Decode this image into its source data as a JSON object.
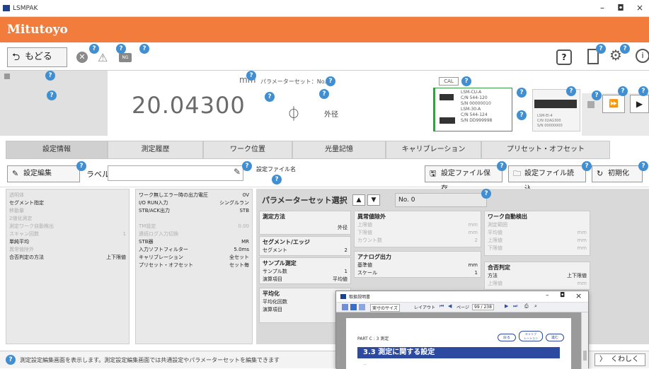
{
  "window": {
    "title": "LSMPAK",
    "minimize": "–",
    "maximize": "◘",
    "close": "×"
  },
  "brand": {
    "name": "Mitutoyo"
  },
  "toolbar": {
    "back_label": "もどる",
    "ng_label": "NG"
  },
  "help_badge": "?",
  "display": {
    "value": "20.04300",
    "unit": "mm",
    "param_set": "パラメーターセット：No. 0",
    "measure_label": "外径",
    "cal_label": "CAL",
    "device1": {
      "lines": [
        "LSM-CU-A",
        "C/N 544-120",
        "S/N 00000010",
        "LSM-30-A",
        "C/N 544-124",
        "S/N DD999998"
      ]
    },
    "device2": {
      "lines": [
        "LSM-EI-4",
        "C/N 02AG300",
        "S/N 00000000"
      ]
    }
  },
  "tabs": [
    "設定情報",
    "測定履歴",
    "ワーク位置",
    "光量記憶",
    "キャリブレーション",
    "プリセット・オフセット"
  ],
  "ctrl": {
    "edit_btn": "設定編集",
    "label_text": "ラベル",
    "label_value": "",
    "file_name_label": "設定ファイル名",
    "save_btn": "設定ファイル保存",
    "load_btn": "設定ファイル読込",
    "init_btn": "初期化"
  },
  "list1": [
    {
      "k": "透明体",
      "v": "",
      "dim": true
    },
    {
      "k": "セグメント指定",
      "v": "",
      "dim": false
    },
    {
      "k": "移動量",
      "v": "",
      "dim": true
    },
    {
      "k": "2値化測定",
      "v": "",
      "dim": true
    },
    {
      "k": "測定ワーク自動検出",
      "v": "",
      "dim": true
    },
    {
      "k": "スキャン回数",
      "v": "1",
      "dim": true
    },
    {
      "k": "単純平均",
      "v": "",
      "dim": false
    },
    {
      "k": "異常値除外",
      "v": "",
      "dim": true
    },
    {
      "k": "合否判定の方法",
      "v": "上下限値",
      "dim": false
    }
  ],
  "list2": [
    {
      "k": "ワーク無しエラー時の出力電圧",
      "v": "0V",
      "dim": false
    },
    {
      "k": "I/O RUN入力",
      "v": "シングルラン",
      "dim": false
    },
    {
      "k": "STB/ACK出力",
      "v": "STB",
      "dim": false
    },
    {
      "k": "",
      "v": "",
      "dim": true
    },
    {
      "k": "TM設定",
      "v": "0.00",
      "dim": true
    },
    {
      "k": "連続ログ入力切換",
      "v": "",
      "dim": true
    },
    {
      "k": "STB器",
      "v": "MR",
      "dim": false
    },
    {
      "k": "入力ソフトフィルター",
      "v": "5.0ms",
      "dim": false
    },
    {
      "k": "キャリブレーション",
      "v": "全セット",
      "dim": false
    },
    {
      "k": "プリセット・オフセット",
      "v": "セット毎",
      "dim": false
    }
  ],
  "panel": {
    "title": "パラメーターセット選択",
    "no_value": "No. 0",
    "measure": {
      "title": "測定方法",
      "value": "外径"
    },
    "segment": {
      "title": "セグメント/エッジ",
      "row": "セグメント",
      "value": "2"
    },
    "sample": {
      "title": "サンプル測定",
      "rows": [
        {
          "k": "サンプル数",
          "v": "1"
        },
        {
          "k": "演算項目",
          "v": "平均値"
        }
      ]
    },
    "average": {
      "title": "平均化",
      "rows": [
        {
          "k": "平均化回数",
          "v": ""
        },
        {
          "k": "演算項目",
          "v": ""
        }
      ]
    },
    "abnormal": {
      "title": "異常値除外",
      "rows": [
        {
          "k": "上限値",
          "v": "mm"
        },
        {
          "k": "下限値",
          "v": "mm"
        },
        {
          "k": "カウント数",
          "v": "2"
        }
      ]
    },
    "analog": {
      "title": "アナログ出力",
      "rows": [
        {
          "k": "基準値",
          "v": "mm"
        },
        {
          "k": "スケール",
          "v": "1"
        }
      ]
    },
    "work": {
      "title": "ワーク自動検出",
      "rows": [
        {
          "k": "測定範囲",
          "v": ""
        },
        {
          "k": "平均値",
          "v": "mm"
        },
        {
          "k": "上限値",
          "v": "mm"
        },
        {
          "k": "下限値",
          "v": "mm"
        }
      ]
    },
    "judge": {
      "title": "合否判定",
      "rows": [
        {
          "k": "方法",
          "v": "上下限値"
        },
        {
          "k": "上限値",
          "v": "mm"
        }
      ]
    }
  },
  "popup": {
    "title": "取扱説明書",
    "zoom": "実寸のサイズ",
    "layout": "レイアウト",
    "page_label": "ページ",
    "page_value": "99 / 238",
    "part": "PART C : 3 測定",
    "section": "3.3   測定に関する設定",
    "line": "...",
    "btn1": "戻る",
    "btn2": "キャリブ\nレーション",
    "btn3": "進む"
  },
  "status": {
    "text": "測定設定編集画面を表示します。測定設定編集画面では共通設定やパラメーターセットを編集できます",
    "detail": "くわしく"
  }
}
